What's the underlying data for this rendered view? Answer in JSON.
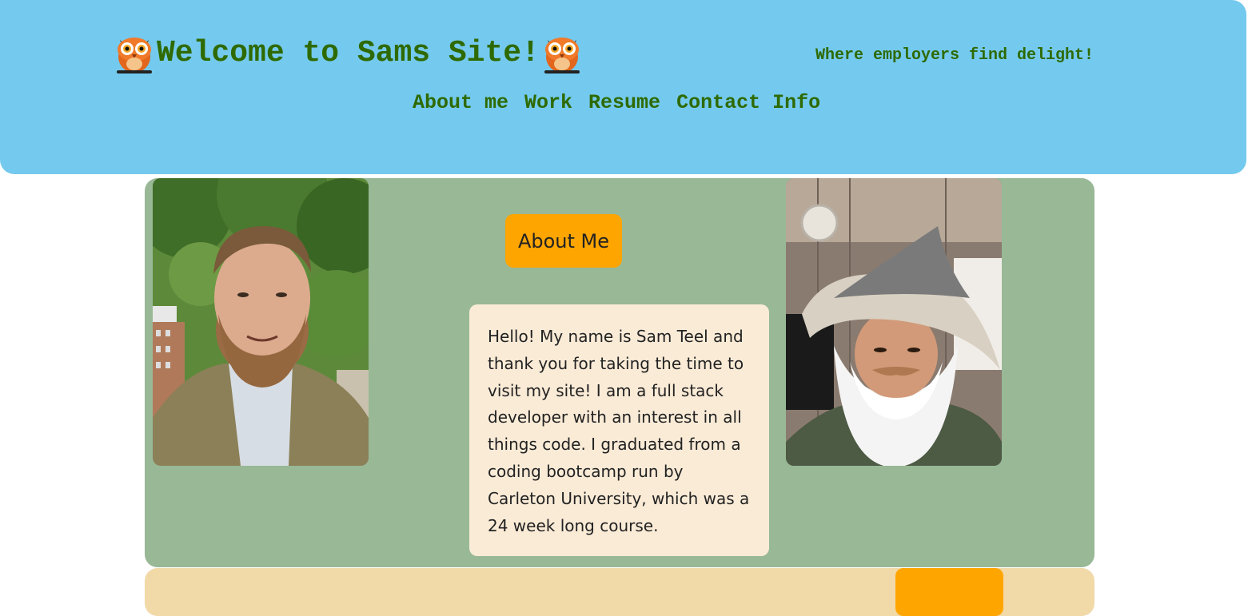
{
  "header": {
    "title": "Welcome to Sams Site!",
    "tagline": "Where employers find delight!",
    "title_icon": "owl-icon",
    "nav": [
      "About me",
      "Work",
      "Resume",
      "Contact Info"
    ]
  },
  "about": {
    "heading": "About Me",
    "bio": "Hello! My name is Sam Teel and thank you for taking the time to visit my site! I am a full stack developer with an interest in all things code. I graduated from a coding bootcamp run by Carleton University, which was a 24 week long course."
  },
  "colors": {
    "header_bg": "#74c9ee",
    "title_text": "#2e6a00",
    "about_bg": "#98b896",
    "heading_button": "#ffa500",
    "bio_card": "#faebd7",
    "next_section_bg": "#f2d9a8"
  }
}
